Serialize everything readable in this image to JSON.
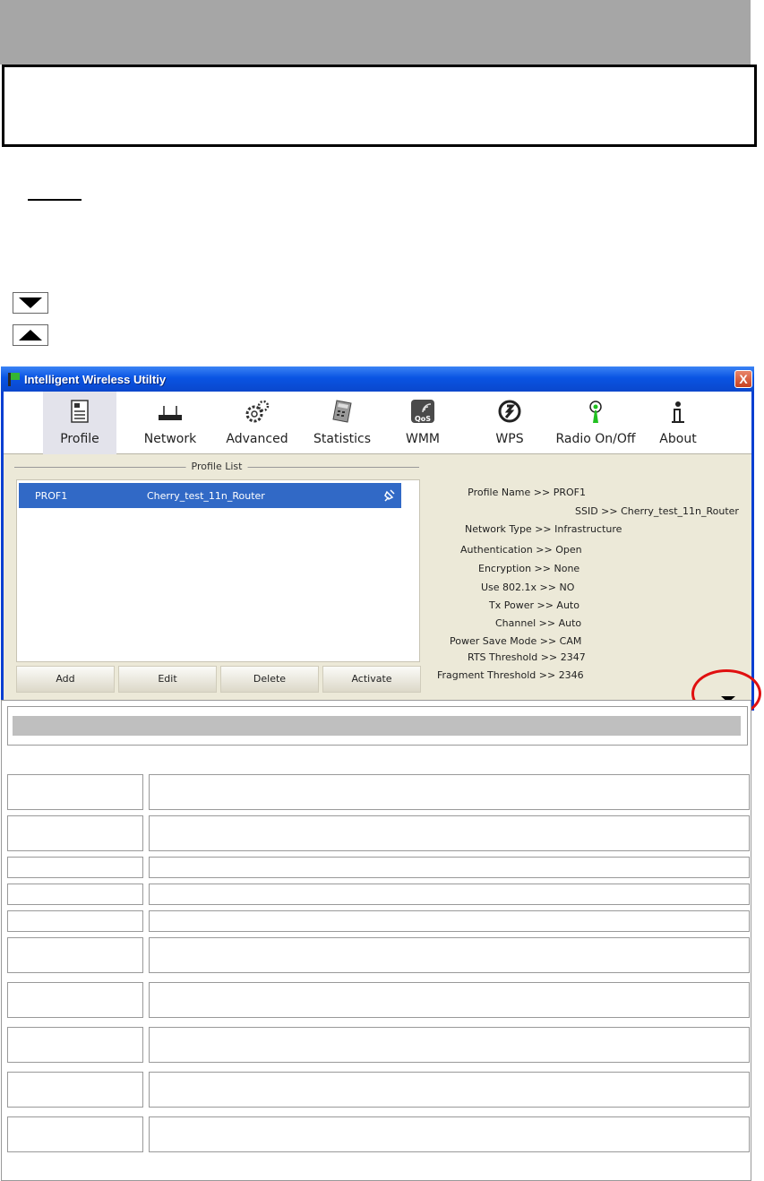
{
  "window": {
    "title": "Intelligent Wireless Utiltiy",
    "close_label": "X"
  },
  "toolbar": {
    "items": [
      {
        "label": "Profile",
        "icon": "profile-icon",
        "active": true
      },
      {
        "label": "Network",
        "icon": "router-icon"
      },
      {
        "label": "Advanced",
        "icon": "gears-icon"
      },
      {
        "label": "Statistics",
        "icon": "calculator-icon"
      },
      {
        "label": "WMM",
        "icon": "qos-icon"
      },
      {
        "label": "WPS",
        "icon": "wps-icon"
      },
      {
        "label": "Radio On/Off",
        "icon": "antenna-icon"
      },
      {
        "label": "About",
        "icon": "info-icon"
      }
    ]
  },
  "profile_list": {
    "legend": "Profile List",
    "rows": [
      {
        "name": "PROF1",
        "ssid": "Cherry_test_11n_Router"
      }
    ]
  },
  "buttons": {
    "add": "Add",
    "edit": "Edit",
    "delete": "Delete",
    "activate": "Activate"
  },
  "details": [
    {
      "label": "Profile Name",
      "value": "PROF1"
    },
    {
      "label": "SSID",
      "value": "Cherry_test_11n_Router"
    },
    {
      "label": "Network Type",
      "value": "Infrastructure"
    },
    {
      "label": "Authentication",
      "value": "Open"
    },
    {
      "label": "Encryption",
      "value": "None"
    },
    {
      "label": "Use 802.1x",
      "value": "NO"
    },
    {
      "label": "Tx Power",
      "value": "Auto"
    },
    {
      "label": "Channel",
      "value": "Auto"
    },
    {
      "label": "Power Save Mode",
      "value": "CAM"
    },
    {
      "label": "RTS Threshold",
      "value": "2347"
    },
    {
      "label": "Fragment Threshold",
      "value": "2346"
    }
  ],
  "colors": {
    "titlebar": "#0a54e3",
    "selection": "#3169c6",
    "highlight_circle": "#e01010"
  }
}
